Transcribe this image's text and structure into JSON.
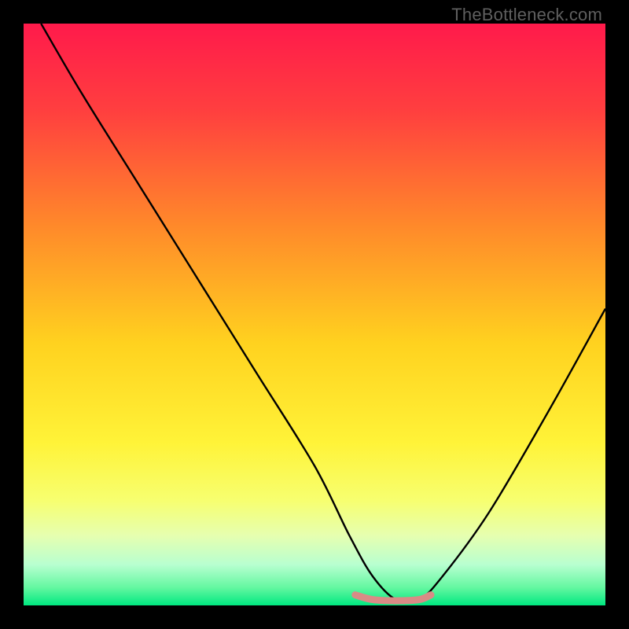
{
  "watermark": "TheBottleneck.com",
  "chart_data": {
    "type": "line",
    "title": "",
    "xlabel": "",
    "ylabel": "",
    "xlim": [
      0,
      100
    ],
    "ylim": [
      0,
      100
    ],
    "grid": false,
    "legend": false,
    "gradient_stops": [
      {
        "offset": 0.0,
        "color": "#ff1a4b"
      },
      {
        "offset": 0.15,
        "color": "#ff3f3f"
      },
      {
        "offset": 0.35,
        "color": "#ff8a2a"
      },
      {
        "offset": 0.55,
        "color": "#ffd21f"
      },
      {
        "offset": 0.72,
        "color": "#fff338"
      },
      {
        "offset": 0.82,
        "color": "#f7ff70"
      },
      {
        "offset": 0.88,
        "color": "#e6ffb0"
      },
      {
        "offset": 0.93,
        "color": "#b8ffd0"
      },
      {
        "offset": 0.97,
        "color": "#62f7a0"
      },
      {
        "offset": 1.0,
        "color": "#00e880"
      }
    ],
    "series": [
      {
        "name": "bottleneck-curve",
        "color": "#000000",
        "x": [
          3,
          10,
          20,
          30,
          40,
          50,
          56,
          60,
          64,
          68,
          72,
          80,
          90,
          100
        ],
        "y": [
          100,
          88,
          72,
          56,
          40,
          24,
          12,
          5,
          1,
          1,
          5,
          16,
          33,
          51
        ]
      }
    ],
    "highlight": {
      "name": "optimal-flat",
      "color": "#d98b86",
      "x": [
        57,
        60,
        64,
        68,
        70
      ],
      "y": [
        1.8,
        1.0,
        0.8,
        1.0,
        1.8
      ]
    }
  }
}
